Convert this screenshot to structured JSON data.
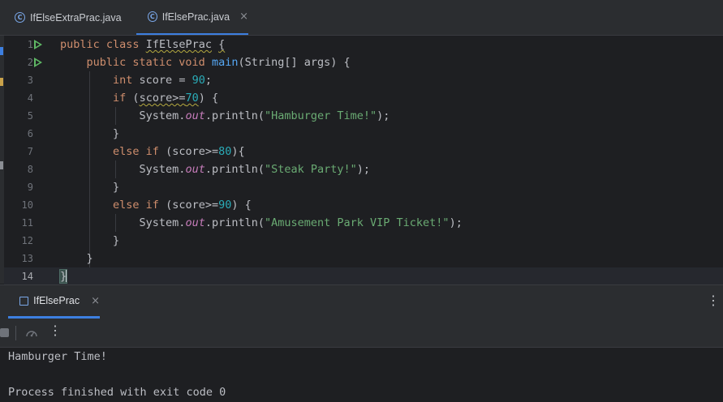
{
  "editor_tabs": [
    {
      "label": "IfElseExtraPrac.java",
      "icon": "class-icon",
      "active": false
    },
    {
      "label": "IfElsePrac.java",
      "icon": "class-icon",
      "active": true,
      "close_glyph": "×"
    }
  ],
  "icon_glyphs": {
    "class": "C",
    "close": "×",
    "more": "⋮"
  },
  "editor": {
    "line_numbers": [
      "1",
      "2",
      "3",
      "4",
      "5",
      "6",
      "7",
      "8",
      "9",
      "10",
      "11",
      "12",
      "13",
      "14"
    ],
    "current_line": 14
  },
  "run_panel": {
    "tab_label": "IfElsePrac",
    "console_lines": [
      "Hamburger Time!",
      "",
      "Process finished with exit code 0"
    ]
  },
  "colors": {
    "keyword": "#cf8e6d",
    "function": "#56a8f5",
    "number": "#2aacb8",
    "string": "#6aab73",
    "static_field": "#c77dbb",
    "accent": "#3d7fe0",
    "run_gutter": "#5fb865"
  }
}
